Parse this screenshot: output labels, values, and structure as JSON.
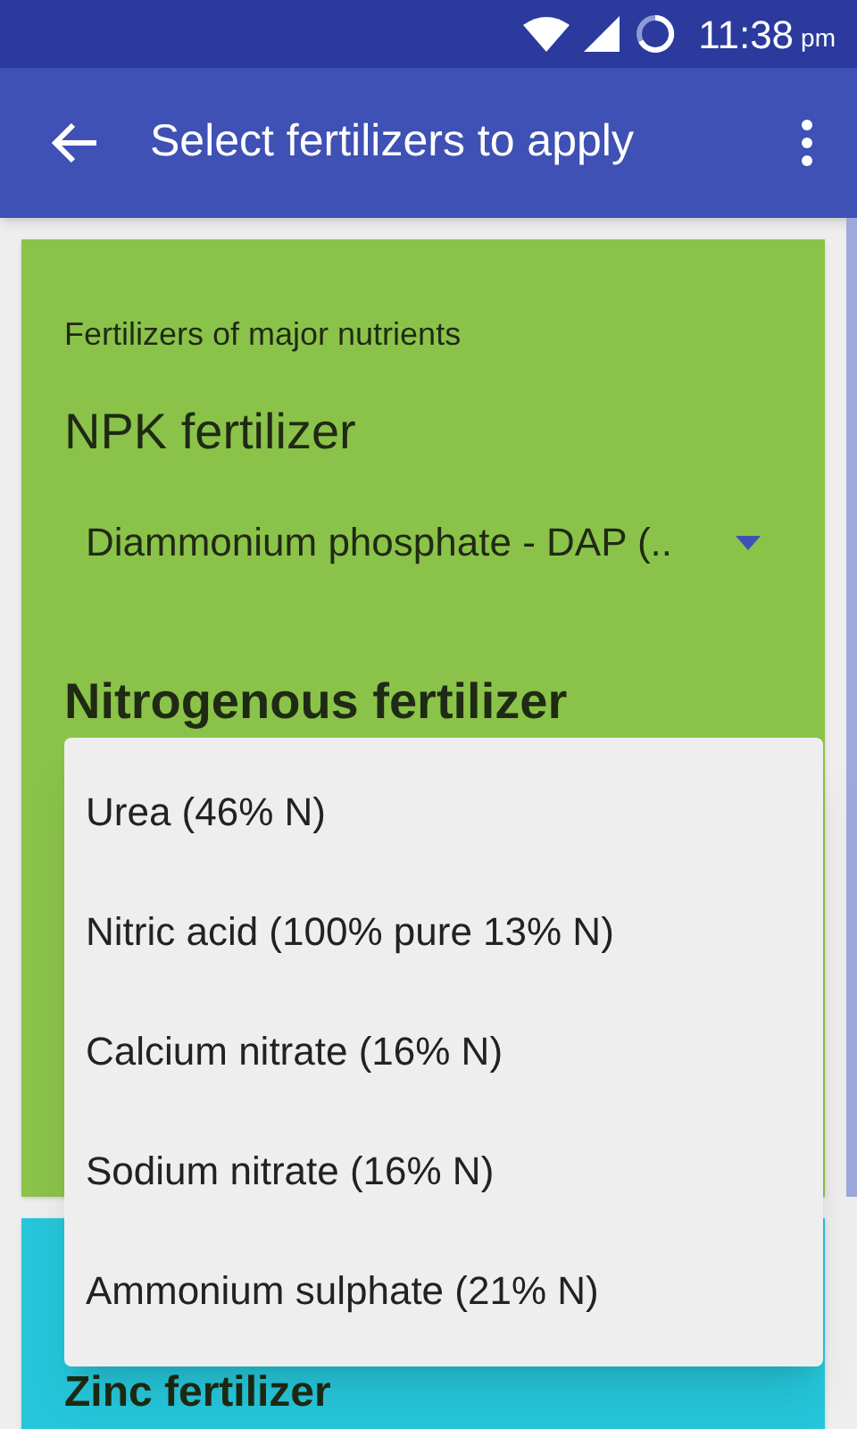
{
  "status_bar": {
    "time": "11:38",
    "ampm": "pm"
  },
  "app_bar": {
    "title": "Select fertilizers to apply"
  },
  "major_card": {
    "heading": "Fertilizers of major nutrients",
    "npk_label": "NPK fertilizer",
    "npk_value": "Diammonium phosphate - DAP (..",
    "nitrogen_label": "Nitrogenous fertilizer"
  },
  "dropdown_options": [
    "Urea (46% N)",
    "Nitric acid (100% pure 13% N)",
    "Calcium nitrate (16% N)",
    "Sodium nitrate (16% N)",
    "Ammonium sulphate (21% N)"
  ],
  "zinc_card": {
    "label": "Zinc fertilizer"
  }
}
